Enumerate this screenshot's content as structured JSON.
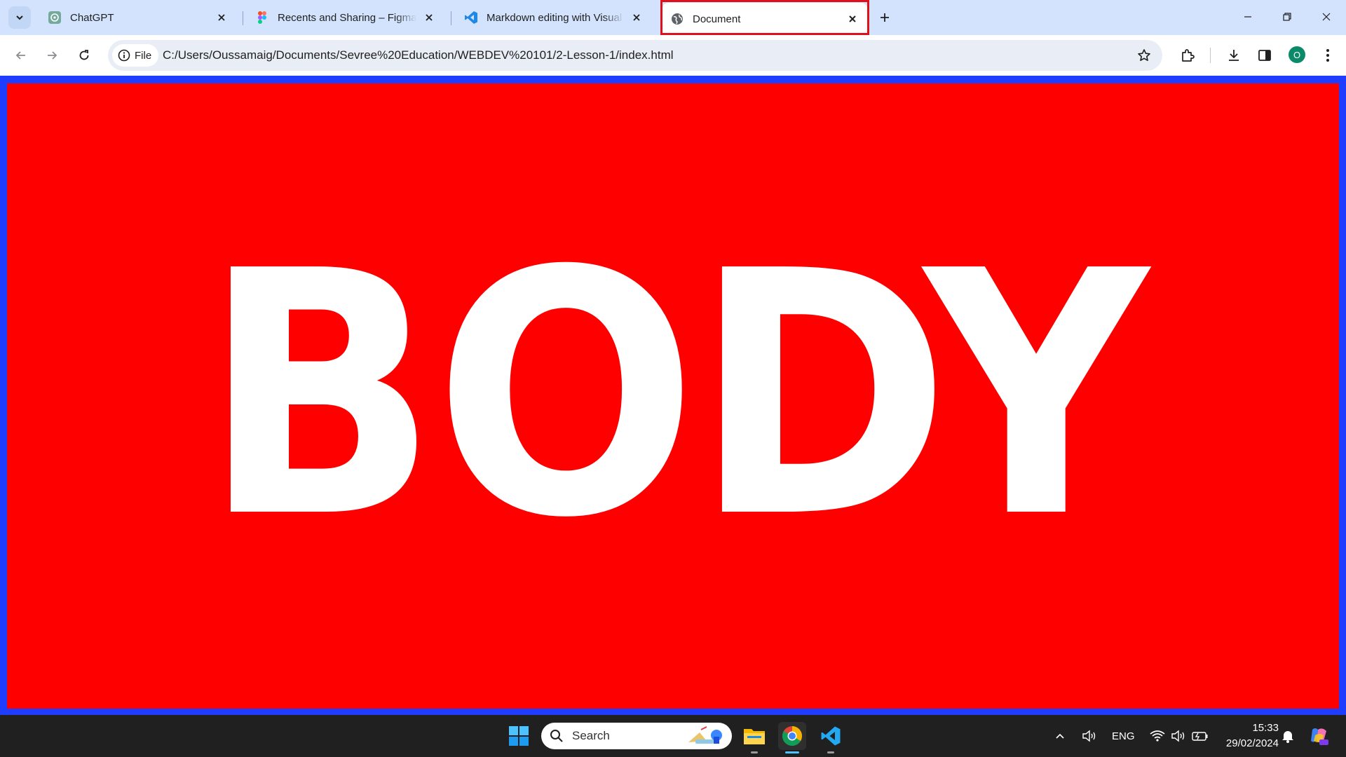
{
  "browser": {
    "tabs": [
      {
        "title": "ChatGPT",
        "icon": "chatgpt-icon",
        "active": false
      },
      {
        "title": "Recents and Sharing – Figma",
        "icon": "figma-icon",
        "active": false
      },
      {
        "title": "Markdown editing with Visual Studio Code",
        "icon": "vscode-icon",
        "active": false
      },
      {
        "title": "Document",
        "icon": "globe-icon",
        "active": true
      }
    ],
    "highlight_color": "#e0101a"
  },
  "toolbar": {
    "site_chip_label": "File",
    "url": "C:/Users/Oussamaig/Documents/Sevree%20Education/WEBDEV%20101/2-Lesson-1/index.html",
    "profile_initial": "O",
    "profile_color": "#0b8a6a"
  },
  "page": {
    "heading": "BODY",
    "background_color": "#ff0000",
    "border_color": "#1f3dff",
    "text_color": "#ffffff"
  },
  "taskbar": {
    "search_placeholder": "Search",
    "language": "ENG",
    "time": "15:33",
    "date": "29/02/2024"
  }
}
